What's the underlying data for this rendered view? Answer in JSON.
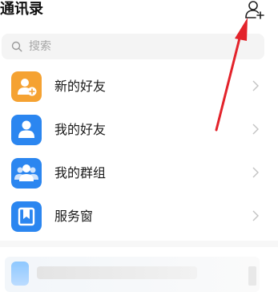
{
  "header": {
    "title": "通讯录",
    "add_icon": "add-person-icon"
  },
  "search": {
    "placeholder": "搜索",
    "value": "",
    "icon": "search-icon"
  },
  "items": [
    {
      "label": "新的好友",
      "icon": "new-friend-icon",
      "color": "#F5A232"
    },
    {
      "label": "我的好友",
      "icon": "friends-icon",
      "color": "#2B86F0"
    },
    {
      "label": "我的群组",
      "icon": "groups-icon",
      "color": "#2B86F0"
    },
    {
      "label": "服务窗",
      "icon": "service-window-icon",
      "color": "#2B86F0"
    }
  ],
  "annotation": {
    "arrow_color": "#E3232B",
    "arrow_icon": "red-arrow-annotation"
  }
}
